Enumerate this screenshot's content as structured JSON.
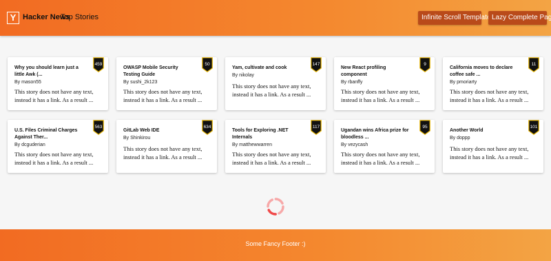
{
  "header": {
    "logo_letter": "Y",
    "brand": "Hacker News",
    "section": "Top Stories",
    "buttons": [
      "Infinite Scroll Template",
      "Lazy Complete Page"
    ]
  },
  "stories": [
    {
      "title": "Why you should learn just a little Awk (...",
      "author": "By mason55",
      "score": "459",
      "excerpt": "This story does not have any text, instead it has a link. As a result ..."
    },
    {
      "title": "OWASP Mobile Security Testing Guide",
      "author": "By sushi_2k123",
      "score": "50",
      "excerpt": "This story does not have any text, instead it has a link. As a result ..."
    },
    {
      "title": "Yam, cultivate and cook",
      "author": "By nikolay",
      "score": "147",
      "excerpt": "This story does not have any text, instead it has a link. As a result ..."
    },
    {
      "title": "New React profiling component",
      "author": "By rbanffy",
      "score": "9",
      "excerpt": "This story does not have any text, instead it has a link. As a result ..."
    },
    {
      "title": "California moves to declare coffee safe ...",
      "author": "By pmoriarty",
      "score": "11",
      "excerpt": "This story does not have any text, instead it has a link. As a result ..."
    },
    {
      "title": "U.S. Files Criminal Charges Against Ther...",
      "author": "By dcguderian",
      "score": "563",
      "excerpt": "This story does not have any text, instead it has a link. As a result ..."
    },
    {
      "title": "GitLab Web IDE",
      "author": "By Shinkirou",
      "score": "634",
      "excerpt": "This story does not have any text, instead it has a link. As a result ..."
    },
    {
      "title": "Tools for Exploring .NET Internals",
      "author": "By matthewwarren",
      "score": "117",
      "excerpt": "This story does not have any text, instead it has a link. As a result ..."
    },
    {
      "title": "Ugandan wins Africa prize for bloodless ...",
      "author": "By vezycash",
      "score": "95",
      "excerpt": "This story does not have any text, instead it has a link. As a result ..."
    },
    {
      "title": "Another World",
      "author": "By doppp",
      "score": "101",
      "excerpt": "This story does not have any text, instead it has a link. As a result ..."
    }
  ],
  "footer": {
    "text": "Some Fancy Footer :)"
  },
  "colors": {
    "header_start": "#f26b22",
    "header_end": "#f3a444",
    "button_bg": "#b94a1a",
    "badge_bg": "#111111",
    "badge_border": "#e6b400"
  }
}
